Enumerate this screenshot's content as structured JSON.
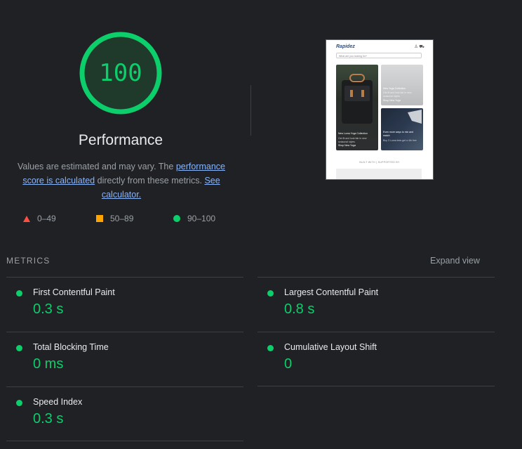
{
  "gauge": {
    "score": "100",
    "title": "Performance",
    "fraction": 1.0,
    "color": "#0cce6b"
  },
  "description": {
    "text1": "Values are estimated and may vary. The ",
    "link1": "performance score is calculated",
    "text2": " directly from these metrics. ",
    "link2": "See calculator."
  },
  "legend": [
    {
      "icon": "triangle-red-icon",
      "label": "0–49",
      "color": "#ff4e42"
    },
    {
      "icon": "square-orange-icon",
      "label": "50–89",
      "color": "#ffa400"
    },
    {
      "icon": "circle-green-icon",
      "label": "90–100",
      "color": "#0cce6b"
    }
  ],
  "thumbnail": {
    "logo": "Rapidez",
    "search_placeholder": "What are you looking for?",
    "cards": [
      {
        "title": "New Luma Yoga Collection",
        "sub": "Get fit and look fab in new seasonal styles",
        "cta": "Shop New Yoga"
      },
      {
        "title": "New Yoga Collection",
        "sub": "Get fit and look fab in new seasonal styles",
        "cta": "Shop New Yoga"
      },
      {
        "title": "Even more ways to mix and match",
        "sub": "Buy 3 Luma tees get a 4th free",
        "cta": ""
      }
    ],
    "built_with": "BUILT WITH | SUPPORTED BY"
  },
  "metrics": {
    "header": "METRICS",
    "expand_label": "Expand view",
    "items": [
      {
        "label": "First Contentful Paint",
        "value": "0.3 s"
      },
      {
        "label": "Largest Contentful Paint",
        "value": "0.8 s"
      },
      {
        "label": "Total Blocking Time",
        "value": "0 ms"
      },
      {
        "label": "Cumulative Layout Shift",
        "value": "0"
      },
      {
        "label": "Speed Index",
        "value": "0.3 s"
      }
    ]
  }
}
